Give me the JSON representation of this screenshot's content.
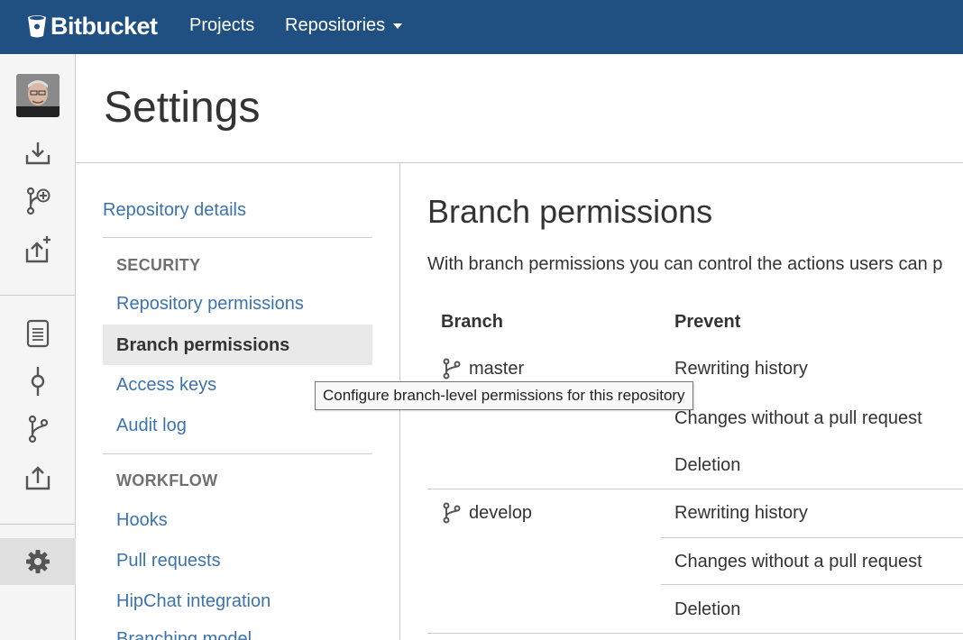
{
  "header": {
    "logo_text": "Bitbucket",
    "nav": [
      {
        "label": "Projects"
      },
      {
        "label": "Repositories"
      }
    ],
    "colors": {
      "background": "#205081",
      "text": "#ffffff"
    }
  },
  "rail": {
    "icons": [
      "avatar",
      "clone-icon",
      "create-branch-icon",
      "create-pull-request-icon",
      "source-icon",
      "commits-icon",
      "branches-icon",
      "pull-requests-icon",
      "settings-icon"
    ]
  },
  "page": {
    "title": "Settings"
  },
  "settings_nav": {
    "repository_details": "Repository details",
    "security_heading": "SECURITY",
    "repository_permissions": "Repository permissions",
    "branch_permissions": "Branch permissions",
    "access_keys": "Access keys",
    "audit_log": "Audit log",
    "workflow_heading": "WORKFLOW",
    "hooks": "Hooks",
    "pull_requests": "Pull requests",
    "hipchat_integration": "HipChat integration",
    "branching_model": "Branching model"
  },
  "main": {
    "title": "Branch permissions",
    "description": "With branch permissions you can control the actions users can p",
    "columns": {
      "branch": "Branch",
      "prevent": "Prevent"
    },
    "rows": [
      {
        "branch": "master",
        "prevent": [
          "Rewriting history",
          "Changes without a pull request",
          "Deletion"
        ]
      },
      {
        "branch": "develop",
        "prevent": [
          "Rewriting history",
          "Changes without a pull request",
          "Deletion"
        ]
      }
    ]
  },
  "tooltip": {
    "text": "Configure branch-level permissions for this repository"
  },
  "colors": {
    "link": "#3b73af",
    "selected_bg": "#e9e9e9",
    "rail_bg": "#f5f5f5"
  }
}
